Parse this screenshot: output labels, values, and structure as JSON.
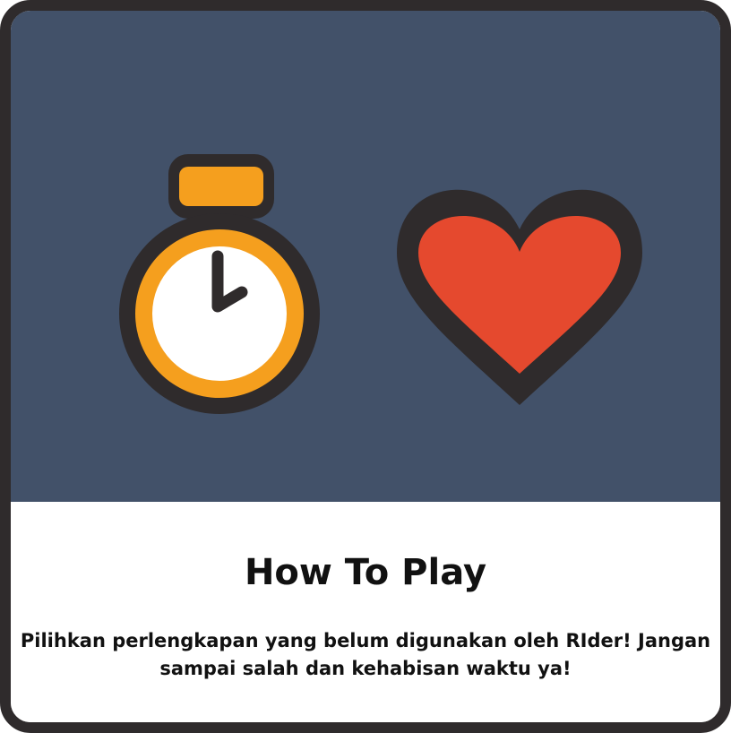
{
  "screen": {
    "title": "How To Play",
    "instructions": "Pilihkan perlengkapan yang belum digunakan oleh RIder! Jangan sampai salah dan kehabisan waktu ya!"
  },
  "icons": {
    "timer": "stopwatch-icon",
    "lives": "heart-icon"
  },
  "colors": {
    "panel_background": "#425169",
    "outline": "#2f2b2c",
    "stopwatch_orange": "#f59f1e",
    "heart_red": "#e5492e",
    "text": "#111111"
  }
}
